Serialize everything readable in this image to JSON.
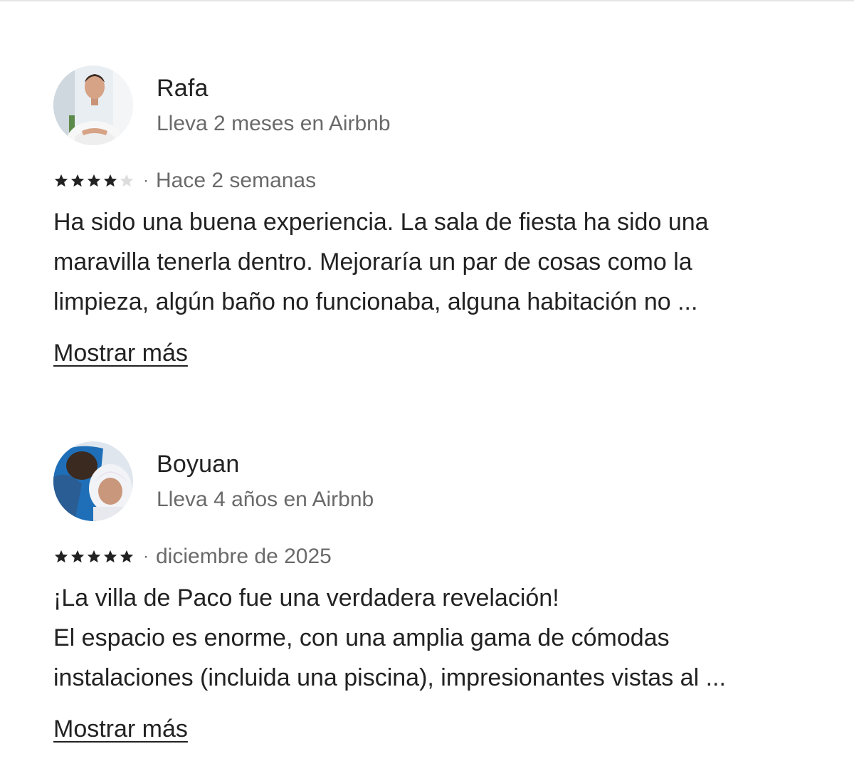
{
  "reviews": [
    {
      "name": "Rafa",
      "tenure": "Lleva 2 meses en Airbnb",
      "rating": 4,
      "date": "Hace 2 semanas",
      "lines": [
        "Ha sido una buena experiencia. La sala de fiesta ha sido una",
        "maravilla tenerla dentro. Mejoraría un par de cosas como la",
        "limpieza, algún baño no funcionaba, alguna habitación no ..."
      ],
      "more_label": "Mostrar más",
      "avatar_icon": "person-photo-avatar"
    },
    {
      "name": "Boyuan",
      "tenure": "Lleva 4 años en Airbnb",
      "rating": 5,
      "date": "diciembre de 2025",
      "lines": [
        "¡La villa de Paco fue una verdadera revelación!",
        "El espacio es enorme, con una amplia gama de cómodas",
        "instalaciones (incluida una piscina), impresionantes vistas al ..."
      ],
      "more_label": "Mostrar más",
      "avatar_icon": "child-photo-avatar"
    }
  ],
  "separator": "·",
  "colors": {
    "text": "#222222",
    "muted": "#6a6a6a",
    "star_filled": "#222222",
    "star_empty": "#dddddd"
  }
}
